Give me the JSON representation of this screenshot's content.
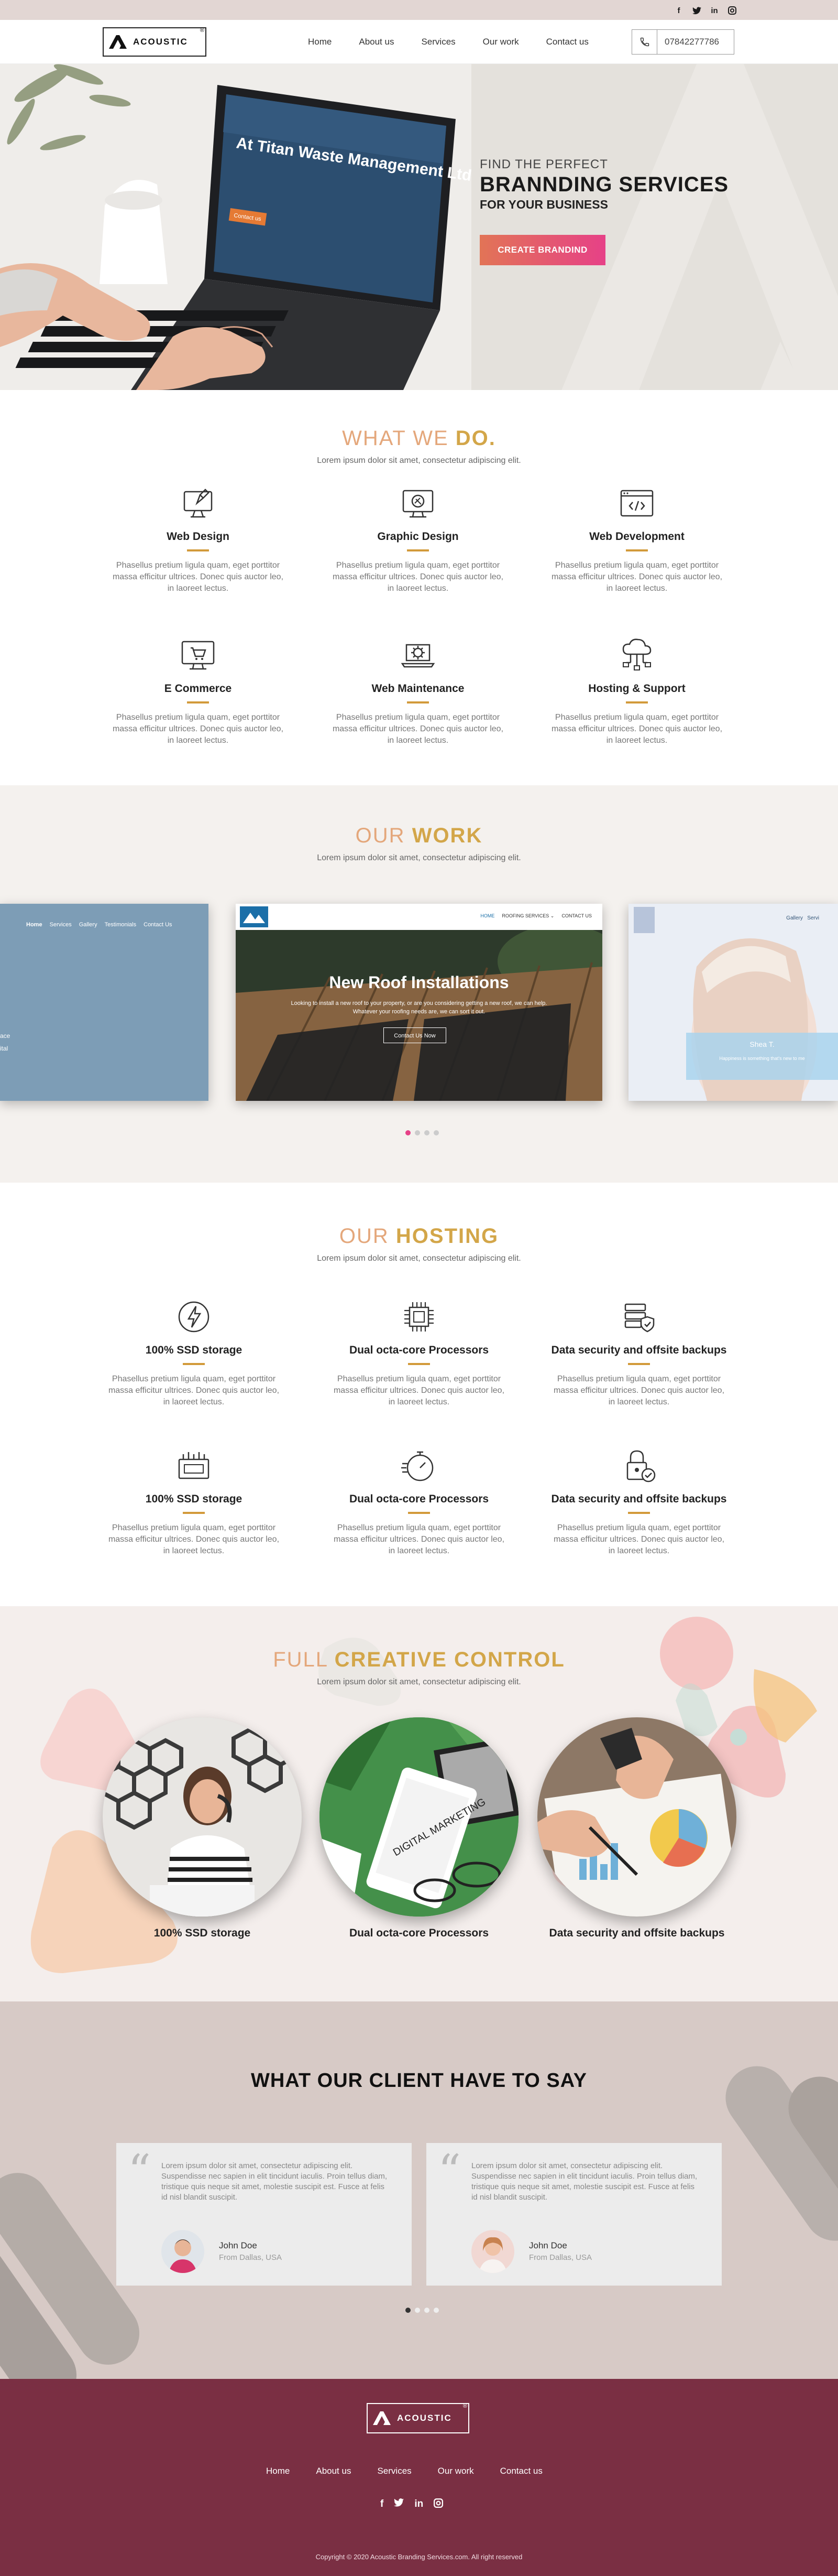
{
  "social": {
    "facebook": "f",
    "twitter": "t",
    "linkedin": "in",
    "instagram": "ig"
  },
  "brand": {
    "name": "ACOUSTIC",
    "reg": "®"
  },
  "nav": {
    "items": [
      "Home",
      "About us",
      "Services",
      "Our work",
      "Contact us"
    ],
    "phone": "07842277786"
  },
  "hero": {
    "line1": "FIND THE PERFECT",
    "line2": "BRANNDING SERVICES",
    "line3": "FOR YOUR BUSINESS",
    "cta": "CREATE BRANDIND",
    "screen_title": "At Titan Waste Management Ltd",
    "screen_button": "Contact us"
  },
  "what_we_do": {
    "title_light": "WHAT WE",
    "title_bold": "DO.",
    "subtitle": "Lorem ipsum dolor sit amet, consectetur adipiscing elit.",
    "items": [
      {
        "icon": "web-design-icon",
        "name": "Web Design",
        "desc": "Phasellus pretium ligula quam, eget porttitor massa efficitur ultrices. Donec quis auctor leo, in laoreet lectus."
      },
      {
        "icon": "graphic-design-icon",
        "name": "Graphic Design",
        "desc": "Phasellus pretium ligula quam, eget porttitor massa efficitur ultrices. Donec quis auctor leo, in laoreet lectus."
      },
      {
        "icon": "web-development-icon",
        "name": "Web Development",
        "desc": "Phasellus pretium ligula quam, eget porttitor massa efficitur ultrices. Donec quis auctor leo, in laoreet lectus."
      },
      {
        "icon": "ecommerce-icon",
        "name": "E Commerce",
        "desc": "Phasellus pretium ligula quam, eget porttitor massa efficitur ultrices. Donec quis auctor leo, in laoreet lectus."
      },
      {
        "icon": "web-maintenance-icon",
        "name": "Web Maintenance",
        "desc": "Phasellus pretium ligula quam, eget porttitor massa efficitur ultrices. Donec quis auctor leo, in laoreet lectus."
      },
      {
        "icon": "hosting-support-icon",
        "name": "Hosting & Support",
        "desc": "Phasellus pretium ligula quam, eget porttitor massa efficitur ultrices. Donec quis auctor leo, in laoreet lectus."
      }
    ]
  },
  "our_work": {
    "title_light": "OUR",
    "title_bold": "WORK",
    "subtitle": "Lorem ipsum dolor sit amet, consectetur adipiscing elit.",
    "left_card_nav": [
      "Home",
      "Services",
      "Gallery",
      "Testimonials",
      "Contact Us"
    ],
    "left_card_text": [
      "ace",
      "ital"
    ],
    "center_card": {
      "nav": [
        "HOME",
        "ROOFING SERVICES ⌄",
        "CONTACT US"
      ],
      "headline": "New Roof Installations",
      "body": "Looking to install a new roof to your property, or are you considering getting a new roof, we can help.",
      "body2": "Whatever your roofing needs are, we can sort it out.",
      "button": "Contact Us Now"
    },
    "right_card": {
      "nav": "Gallery",
      "nav2": "Servi",
      "caption": "Shea T.",
      "caption2": "Happiness is something that's new to me"
    },
    "dots": 4,
    "active_dot": 0
  },
  "hosting": {
    "title_light": "OUR",
    "title_bold": "HOSTING",
    "subtitle": "Lorem ipsum dolor sit amet, consectetur adipiscing elit.",
    "items": [
      {
        "icon": "lightning-icon",
        "name": "100% SSD storage",
        "desc": "Phasellus pretium ligula quam, eget porttitor massa efficitur ultrices. Donec quis auctor leo, in laoreet lectus."
      },
      {
        "icon": "processor-icon",
        "name": "Dual octa-core Processors",
        "desc": "Phasellus pretium ligula quam, eget porttitor massa efficitur ultrices. Donec quis auctor leo, in laoreet lectus."
      },
      {
        "icon": "data-security-icon",
        "name": "Data security and offsite backups",
        "desc": "Phasellus pretium ligula quam, eget porttitor massa efficitur ultrices. Donec quis auctor leo, in laoreet lectus."
      },
      {
        "icon": "storage-icon",
        "name": "100% SSD storage",
        "desc": "Phasellus pretium ligula quam, eget porttitor massa efficitur ultrices. Donec quis auctor leo, in laoreet lectus."
      },
      {
        "icon": "stopwatch-icon",
        "name": "Dual octa-core Processors",
        "desc": "Phasellus pretium ligula quam, eget porttitor massa efficitur ultrices. Donec quis auctor leo, in laoreet lectus."
      },
      {
        "icon": "lock-icon",
        "name": "Data security and offsite backups",
        "desc": "Phasellus pretium ligula quam, eget porttitor massa efficitur ultrices. Donec quis auctor leo, in laoreet lectus."
      }
    ]
  },
  "creative": {
    "title_light": "FULL",
    "title_bold": "CREATIVE CONTROL",
    "subtitle": "Lorem ipsum dolor sit amet, consectetur adipiscing elit.",
    "items": [
      "100% SSD storage",
      "Dual octa-core Processors",
      "Data security and offsite backups"
    ],
    "tablet_text": "DIGITAL MARKETING"
  },
  "testimonials": {
    "title": "WHAT OUR CLIENT HAVE TO SAY",
    "items": [
      {
        "text": "Lorem ipsum dolor sit amet, consectetur adipiscing elit. Suspendisse nec sapien in elit tincidunt iaculis. Proin tellus diam, tristique quis neque sit amet, molestie suscipit est. Fusce at felis id nisl blandit suscipit.",
        "name": "John Doe",
        "from": "From Dallas, USA"
      },
      {
        "text": "Lorem ipsum dolor sit amet, consectetur adipiscing elit. Suspendisse nec sapien in elit tincidunt iaculis. Proin tellus diam, tristique quis neque sit amet, molestie suscipit est. Fusce at felis id nisl blandit suscipit.",
        "name": "John Doe",
        "from": "From Dallas, USA"
      }
    ],
    "dots": 4,
    "active_dot": 0
  },
  "footer": {
    "items": [
      "Home",
      "About us",
      "Services",
      "Our work",
      "Contact us"
    ],
    "copyright": "Copyright © 2020 Acoustic Branding Services.com. All right reserved"
  },
  "colors": {
    "accent_pink": "#e64187",
    "accent_gold": "#d29a3a",
    "footer_bg": "#7a2f43",
    "topbar_bg": "#e2d6d3"
  }
}
